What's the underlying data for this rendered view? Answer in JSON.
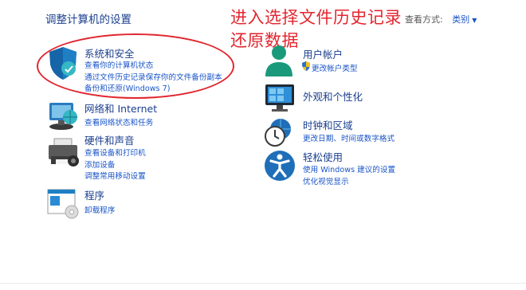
{
  "page_title": "调整计算机的设置",
  "annotation": {
    "line1": "进入选择文件历史记录",
    "line2": "还原数据"
  },
  "view_by": {
    "label": "查看方式:",
    "value": "类别"
  },
  "categories": {
    "security": {
      "title": "系统和安全",
      "links": [
        "查看你的计算机状态",
        "通过文件历史记录保存你的文件备份副本",
        "备份和还原(Windows 7)"
      ]
    },
    "network": {
      "title": "网络和 Internet",
      "links": [
        "查看网络状态和任务"
      ]
    },
    "hardware": {
      "title": "硬件和声音",
      "links": [
        "查看设备和打印机",
        "添加设备",
        "调整常用移动设置"
      ]
    },
    "programs": {
      "title": "程序",
      "links": [
        "卸载程序"
      ]
    },
    "accounts": {
      "title": "用户帐户",
      "links": [
        "更改帐户类型"
      ]
    },
    "appearance": {
      "title": "外观和个性化",
      "links": []
    },
    "clock": {
      "title": "时钟和区域",
      "links": [
        "更改日期、时间或数字格式"
      ]
    },
    "ease": {
      "title": "轻松使用",
      "links": [
        "使用 Windows 建议的设置",
        "优化视觉显示"
      ]
    }
  },
  "colors": {
    "link": "#1a55c9",
    "title": "#1b3f8f",
    "annotation": "#e3262f"
  },
  "icons": [
    "shield-icon",
    "network-icon",
    "printer-icon",
    "programs-icon",
    "user-icon",
    "uac-shield-icon",
    "monitor-icon",
    "clock-icon",
    "accessibility-icon"
  ]
}
